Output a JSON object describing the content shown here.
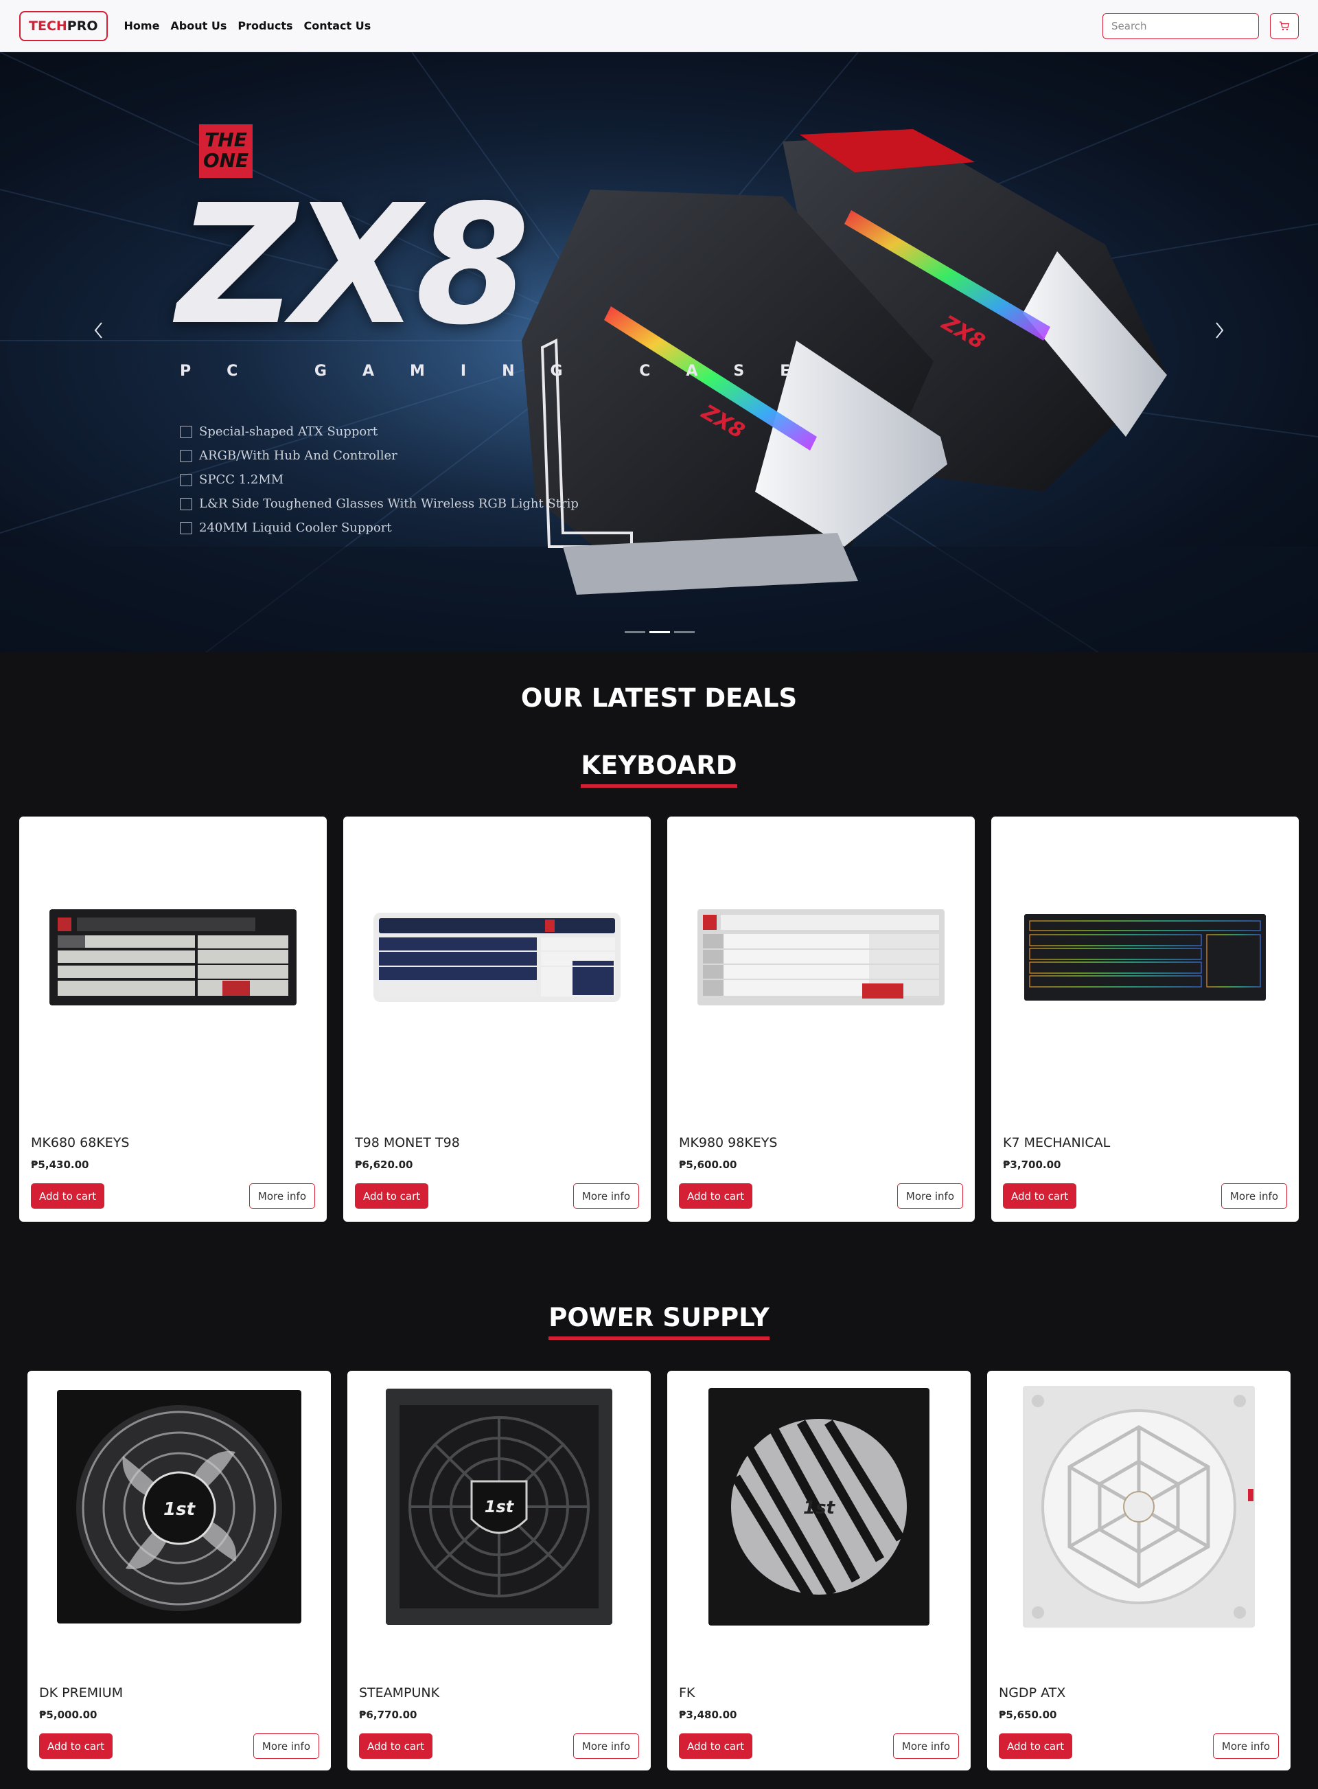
{
  "nav": {
    "brand_part1": "TECH",
    "brand_part2": "PRO",
    "links": [
      "Home",
      "About Us",
      "Products",
      "Contact Us"
    ],
    "search_placeholder": "Search"
  },
  "hero": {
    "logo_line1": "THE",
    "logo_line2": "ONE",
    "title": "ZX8",
    "subtitle": "PC GAMING CASE",
    "features": [
      "Special-shaped ATX Support",
      "ARGB/With Hub And Controller",
      "SPCC 1.2MM",
      "L&R Side Toughened Glasses With Wireless RGB Light Strip",
      "240MM Liquid Cooler Support"
    ],
    "product_label": "ZX8",
    "slide_count": 3,
    "active_slide": 2
  },
  "deals_title": "OUR LATEST DEALS",
  "keyboard": {
    "title": "KEYBOARD",
    "products": [
      {
        "name": "MK680 68KEYS",
        "price": "₱5,430.00",
        "add": "Add to cart",
        "more": "More info"
      },
      {
        "name": "T98 MONET T98",
        "price": "₱6,620.00",
        "add": "Add to cart",
        "more": "More info"
      },
      {
        "name": "MK980 98KEYS",
        "price": "₱5,600.00",
        "add": "Add to cart",
        "more": "More info"
      },
      {
        "name": "K7 MECHANICAL",
        "price": "₱3,700.00",
        "add": "Add to cart",
        "more": "More info"
      }
    ]
  },
  "power_supply": {
    "title": "POWER SUPPLY",
    "products": [
      {
        "name": "DK PREMIUM",
        "price": "₱5,000.00",
        "add": "Add to cart",
        "more": "More info"
      },
      {
        "name": "STEAMPUNK",
        "price": "₱6,770.00",
        "add": "Add to cart",
        "more": "More info"
      },
      {
        "name": "FK",
        "price": "₱3,480.00",
        "add": "Add to cart",
        "more": "More info"
      },
      {
        "name": "NGDP ATX",
        "price": "₱5,650.00",
        "add": "Add to cart",
        "more": "More info"
      }
    ]
  },
  "colors": {
    "accent": "#d41f35",
    "page_bg": "#111113",
    "nav_bg": "#f8f8fa"
  },
  "icons": {
    "cart": "cart-icon",
    "prev": "chevron-left-icon",
    "next": "chevron-right-icon"
  }
}
